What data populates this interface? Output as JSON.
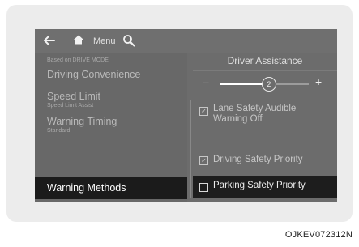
{
  "topbar": {
    "menu_label": "Menu",
    "icons": [
      "back-arrow-icon",
      "home-icon",
      "search-icon"
    ]
  },
  "left_menu": {
    "header_small": "Based on DRIVE MODE",
    "items": [
      {
        "label": "Driving Convenience",
        "subtitle": ""
      },
      {
        "label": "Speed Limit",
        "subtitle": "Speed Limit Assist"
      },
      {
        "label": "Warning Timing",
        "subtitle": "Standard"
      },
      {
        "label": "Warning Methods",
        "subtitle": ""
      }
    ]
  },
  "right_panel": {
    "title": "Driver Assistance",
    "slider": {
      "minus_label": "−",
      "plus_label": "+",
      "value": "2",
      "fill_fraction": 0.55
    },
    "options": [
      {
        "label_line1": "Lane Safety Audible",
        "label_line2": "Warning Off",
        "checked": true
      },
      {
        "label_line1": "Driving Safety Priority",
        "label_line2": "",
        "checked": true
      },
      {
        "label_line1": "Parking Safety Priority",
        "label_line2": "",
        "checked": false
      }
    ]
  },
  "caption": "OJKEV072312N",
  "colors": {
    "screen_bg": "#6c6c6c",
    "selected_bg": "#1b1b1b",
    "text_dim": "#b9b9b9",
    "text_bright": "#ffffff"
  }
}
